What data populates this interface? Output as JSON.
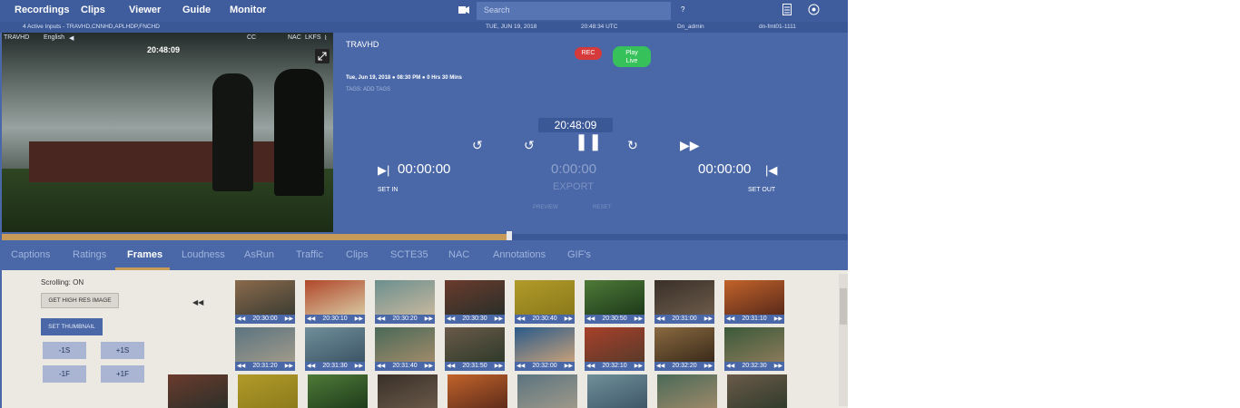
{
  "nav": {
    "items": [
      "Recordings",
      "Clips",
      "Viewer",
      "Guide",
      "Monitor"
    ],
    "search_placeholder": "Search",
    "help": "?"
  },
  "status_bar": {
    "inputs": "4 Active Inputs - TRAVHD,CNNHD,APLHDP,FNCHD",
    "date": "TUE, JUN 19, 2018",
    "time_utc": "20:48:34 UTC",
    "user": "Dn_admin",
    "server": "dn-fmt01-1111"
  },
  "video": {
    "channel": "TRAVHD",
    "language": "English",
    "cc": "CC",
    "nac": "NAC",
    "lkfs": "LKFS",
    "timestamp": "20:48:09"
  },
  "player": {
    "channel": "TRAVHD",
    "rec_label": "REC",
    "live_label_1": "Play",
    "live_label_2": "Live",
    "date": "Tue, Jun 19, 2018",
    "start": "08:30 PM",
    "duration": "0 Hrs 30 Mins",
    "tags_label": "TAGS:",
    "add_tags": "ADD TAGS",
    "current_time": "20:48:09",
    "set_in_time": "00:00:00",
    "export_time": "0:00:00",
    "set_out_time": "00:00:00",
    "export_label": "EXPORT",
    "set_in_label": "SET IN",
    "set_out_label": "SET OUT",
    "preview_label": "PREVIEW",
    "reset_label": "RESET",
    "scrub_progress": 0.6
  },
  "tabs": [
    "Captions",
    "Ratings",
    "Frames",
    "Loudness",
    "AsRun",
    "Traffic",
    "Clips",
    "SCTE35",
    "NAC",
    "Annotations",
    "GIF's"
  ],
  "active_tab": "Frames",
  "frames_panel": {
    "scrolling": "Scrolling: ON",
    "hires_button": "GET HIGH RES IMAGE",
    "thumbnail_button": "SET THUMBNAIL",
    "minus_1s": "-1S",
    "plus_1s": "+1S",
    "minus_1f": "-1F",
    "plus_1f": "+1F",
    "row1": [
      "20:30:00",
      "20:30:10",
      "20:30:20",
      "20:30:30",
      "20:30:40",
      "20:30:50",
      "20:31:00",
      "20:31:10"
    ],
    "row2": [
      "20:31:20",
      "20:31:30",
      "20:31:40",
      "20:31:50",
      "20:32:00",
      "20:32:10",
      "20:32:20",
      "20:32:30"
    ],
    "colors": {
      "accent": "#4a68a8",
      "rec": "#d63a3a",
      "live": "#36c15a",
      "scrub": "#c79a5a"
    }
  }
}
